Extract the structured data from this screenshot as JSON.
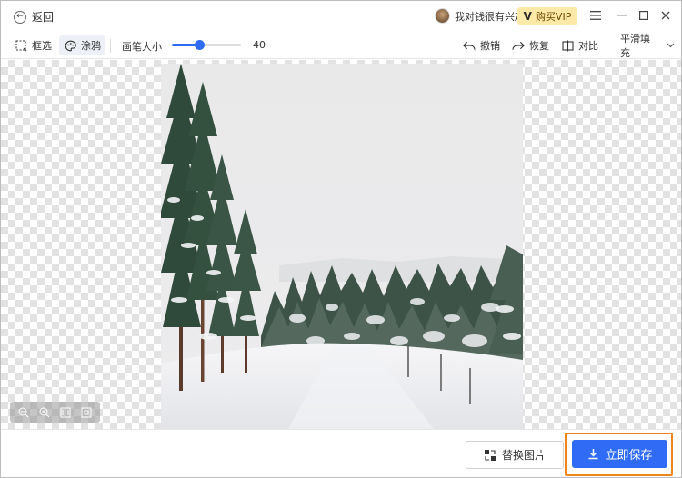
{
  "titlebar": {
    "back_label": "返回",
    "username": "我对钱很有兴趣",
    "vip_label": "购买VIP",
    "vip_color": "#ffe9a8"
  },
  "toolbar": {
    "box_select_label": "框选",
    "paint_label": "涂鸦",
    "brush_size_label": "画笔大小",
    "brush_size_value": "40",
    "brush_size_fraction": 0.4,
    "undo_label": "撤销",
    "redo_label": "恢复",
    "compare_label": "对比",
    "fill_mode_label": "平滑填充",
    "accent_color": "#2f6bf5"
  },
  "canvas": {
    "zoom_tools": [
      "zoom-out-icon",
      "zoom-in-icon",
      "fit-width-icon",
      "fit-screen-icon"
    ]
  },
  "bottom": {
    "replace_label": "替换图片",
    "save_label": "立即保存",
    "save_color": "#2f6bf5",
    "highlight_color": "#f0861a"
  }
}
